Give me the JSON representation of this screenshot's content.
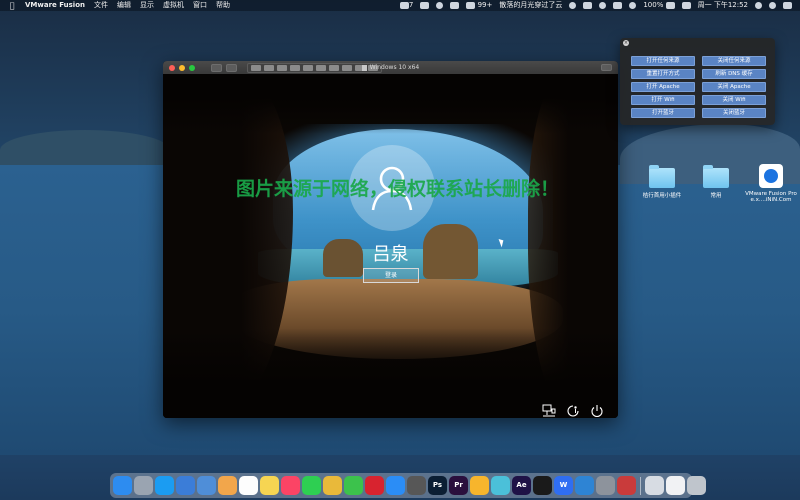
{
  "menubar": {
    "app_name": "VMware Fusion",
    "menus": [
      "文件",
      "编辑",
      "显示",
      "虚拟机",
      "窗口",
      "帮助"
    ],
    "notifications_count": "7",
    "badge_99": "99+",
    "media_title": "散落的月光穿过了云",
    "battery": "100%",
    "datetime": "周一 下午12:52"
  },
  "vm_window": {
    "title": "Windows 10 x64",
    "username": "吕泉",
    "login_label": "登录"
  },
  "watermark": "图片来源于网络，侵权联系站长删除！",
  "script_panel": {
    "left_buttons": [
      "打开任何来源",
      "重置打开方式",
      "打开 Apache",
      "打开 Wifi",
      "打开蓝牙"
    ],
    "right_buttons": [
      "关闭任何来源",
      "刷新 DNS 缓存",
      "关闭 Apache",
      "关闭 Wifi",
      "关闭蓝牙"
    ]
  },
  "desktop_icons": [
    {
      "label": "桔行首用小插件"
    },
    {
      "label": "常用"
    },
    {
      "label": "VMware Fusion Pro e.x....iNiN.Com"
    }
  ],
  "dock": {
    "apps": [
      {
        "name": "finder",
        "color": "#2d8cf0",
        "label": ""
      },
      {
        "name": "launchpad",
        "color": "#9aa4b1",
        "label": ""
      },
      {
        "name": "safari",
        "color": "#1b9cf2",
        "label": ""
      },
      {
        "name": "qq-mail",
        "color": "#3b7dd8",
        "label": ""
      },
      {
        "name": "chrome-blue",
        "color": "#4f8ed8",
        "label": ""
      },
      {
        "name": "photos",
        "color": "#f2a64b",
        "label": ""
      },
      {
        "name": "calendar",
        "color": "#fdfdfd",
        "label": ""
      },
      {
        "name": "notes",
        "color": "#f6d552",
        "label": ""
      },
      {
        "name": "music",
        "color": "#fb4465",
        "label": ""
      },
      {
        "name": "messages",
        "color": "#2ecf52",
        "label": ""
      },
      {
        "name": "chrome",
        "color": "#e9b93a",
        "label": ""
      },
      {
        "name": "wechat",
        "color": "#3cc24c",
        "label": ""
      },
      {
        "name": "netease-music",
        "color": "#d8232f",
        "label": ""
      },
      {
        "name": "app-store",
        "color": "#2b8df6",
        "label": ""
      },
      {
        "name": "activity-monitor",
        "color": "#575757",
        "label": ""
      },
      {
        "name": "photoshop",
        "color": "#0b1e33",
        "label": "Ps"
      },
      {
        "name": "premiere",
        "color": "#2a0f3d",
        "label": "Pr"
      },
      {
        "name": "sketch",
        "color": "#f7b52c",
        "label": ""
      },
      {
        "name": "xcode-tool",
        "color": "#4bc0d9",
        "label": ""
      },
      {
        "name": "after-effects",
        "color": "#1f1246",
        "label": "Ae"
      },
      {
        "name": "qq",
        "color": "#1a1a1a",
        "label": ""
      },
      {
        "name": "wps",
        "color": "#2f6ef2",
        "label": "W"
      },
      {
        "name": "quicktime",
        "color": "#2e84d4",
        "label": ""
      },
      {
        "name": "system-preferences",
        "color": "#8d939c",
        "label": ""
      },
      {
        "name": "screen-share",
        "color": "#c93b3b",
        "label": ""
      }
    ],
    "trailing": [
      {
        "name": "downloads-stack",
        "color": "#d7dce3"
      },
      {
        "name": "folder-stack",
        "color": "#f1f2f4"
      },
      {
        "name": "trash",
        "color": "#bfc5cc"
      }
    ]
  }
}
